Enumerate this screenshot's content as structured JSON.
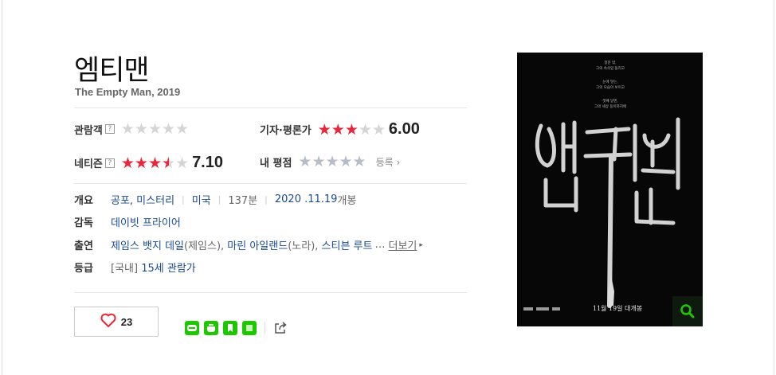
{
  "movie": {
    "title": "엠티맨",
    "subtitle": "The Empty Man, 2019"
  },
  "ratings": {
    "audience_label": "관람객",
    "audience_help": "?",
    "audience_score": 0,
    "critic_label": "기자·평론가",
    "critic_score": "6.00",
    "netizen_label": "네티즌",
    "netizen_help": "?",
    "netizen_score": "7.10",
    "my_label": "내 평점",
    "register_label": "등록",
    "star_color": "#e8283a",
    "star_empty_color": "#d5d5d5"
  },
  "info": {
    "overview_label": "개요",
    "genre": "공포, 미스터리",
    "country": "미국",
    "runtime": "137분",
    "release": "2020 .11.19",
    "release_suffix": "개봉",
    "director_label": "감독",
    "director": "데이빗 프라이어",
    "cast_label": "출연",
    "cast1": "제임스 뱃지 데일",
    "cast1_role": "(제임스),",
    "cast2": "마린 아일랜드",
    "cast2_role": "(노라),",
    "cast3": "스티븐 루트",
    "ellipsis": "…",
    "more_label": "더보기",
    "grade_label": "등급",
    "grade_region": "[국내]",
    "grade": "15세 관람가"
  },
  "actions": {
    "like_count": "23",
    "share_icons": [
      "blog-icon",
      "cafe-icon",
      "bookmark-icon",
      "memo-icon",
      "share-icon"
    ]
  },
  "poster": {
    "top_lines": [
      "창문 밖,",
      "그의 속삭임 들리고",
      "눈에 닿는,",
      "그의 모습이 보이고",
      "셋째 날엔,",
      "그의 세상 동이까지에"
    ],
    "title_art": "엠티맨",
    "release_line": "11월 19일 대개봉"
  }
}
